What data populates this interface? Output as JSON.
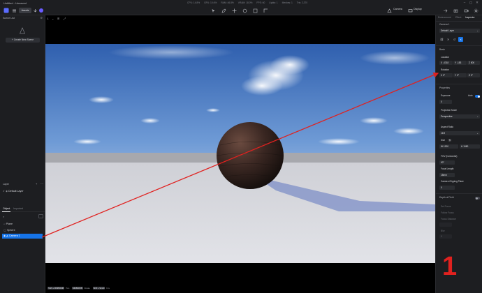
{
  "window": {
    "title": "Untitled - Unsaved",
    "stats": [
      "CPU: 14.8%",
      "GPU: 10.6%",
      "RAM: 46.8%",
      "VRAM: 18.0%",
      "FPS: 60",
      "Lights: 1",
      "Meshes: 1",
      "Tris: 2,370"
    ]
  },
  "toolbar": {
    "assets_label": "Assets",
    "camera_label": "Camera",
    "display_label": "Display"
  },
  "left": {
    "scene_list_label": "Scene List",
    "create_scene_label": "Create New Scene",
    "layer_label": "Layer",
    "default_layer": "Default Layer",
    "tab_object": "Object",
    "tab_imported": "Imported",
    "objects": [
      "Plane",
      "Sphere",
      "Camera 1"
    ]
  },
  "viewport": {
    "hints": [
      {
        "key": "Shift + MMB/RMB",
        "text": "Pan"
      },
      {
        "key": "MMB/RMB",
        "text": "Rotate"
      },
      {
        "key": "Shift + Scroll",
        "text": "Fov"
      }
    ]
  },
  "right": {
    "tabs": [
      "Environment",
      "Effect",
      "Inspector"
    ],
    "camera_name": "Camera 1",
    "layer_value": "Default Layer",
    "section_basic": "Basic",
    "location_label": "Location",
    "loc_x": "X -4318",
    "loc_y": "Y -183",
    "loc_z": "Z 800",
    "rotation_label": "Rotation",
    "rot_x": "X 0°",
    "rot_y": "Y 0°",
    "rot_z": "Z 0°",
    "section_properties": "Properties",
    "exposure_label": "Exposure",
    "exposure_auto": "Auto",
    "exposure_value": "0",
    "projection_label": "Projection Mode",
    "projection_value": "Perspective",
    "aspect_label": "Aspect Ratio",
    "aspect_value": "16:9",
    "size_label": "Size",
    "size_w": "W 1920",
    "size_h": "H 1080",
    "fov_label": "FOV (horizontal)",
    "fov_value": "90°",
    "focal_label": "Focal Length",
    "focal_value": "18mm",
    "clip_label": "Camera Clipping Plane",
    "clip_value": "0",
    "dof_label": "Depth of Field",
    "dof_items": [
      "Set Focus",
      "Follow Focus",
      "Focus Distance",
      "Blur"
    ],
    "dof_blur_value": "0"
  },
  "annotation": {
    "number": "1",
    "color": "#e0211f"
  },
  "colors": {
    "accent": "#1674e8",
    "panel": "#1d1e21"
  }
}
